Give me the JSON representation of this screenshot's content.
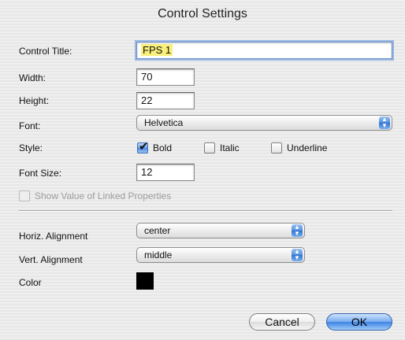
{
  "window": {
    "title": "Control Settings"
  },
  "form": {
    "control_title": {
      "label": "Control Title:",
      "value": "FPS 1"
    },
    "width": {
      "label": "Width:",
      "value": "70"
    },
    "height": {
      "label": "Height:",
      "value": "22"
    },
    "font": {
      "label": "Font:",
      "value": "Helvetica"
    },
    "style": {
      "label": "Style:",
      "options": [
        {
          "label": "Bold",
          "checked": true
        },
        {
          "label": "Italic",
          "checked": false
        },
        {
          "label": "Underline",
          "checked": false
        }
      ]
    },
    "font_size": {
      "label": "Font Size:",
      "value": "12"
    },
    "show_linked": {
      "label": "Show Value of Linked Properties",
      "checked": false,
      "enabled": false
    },
    "horiz_alignment": {
      "label": "Horiz. Alignment",
      "value": "center"
    },
    "vert_alignment": {
      "label": "Vert. Alignment",
      "value": "middle"
    },
    "color": {
      "label": "Color",
      "value": "#000000"
    }
  },
  "buttons": {
    "cancel": "Cancel",
    "ok": "OK"
  },
  "icons": {
    "popup_arrows": "updown-arrows-icon",
    "checkmark": "checkmark-icon"
  }
}
